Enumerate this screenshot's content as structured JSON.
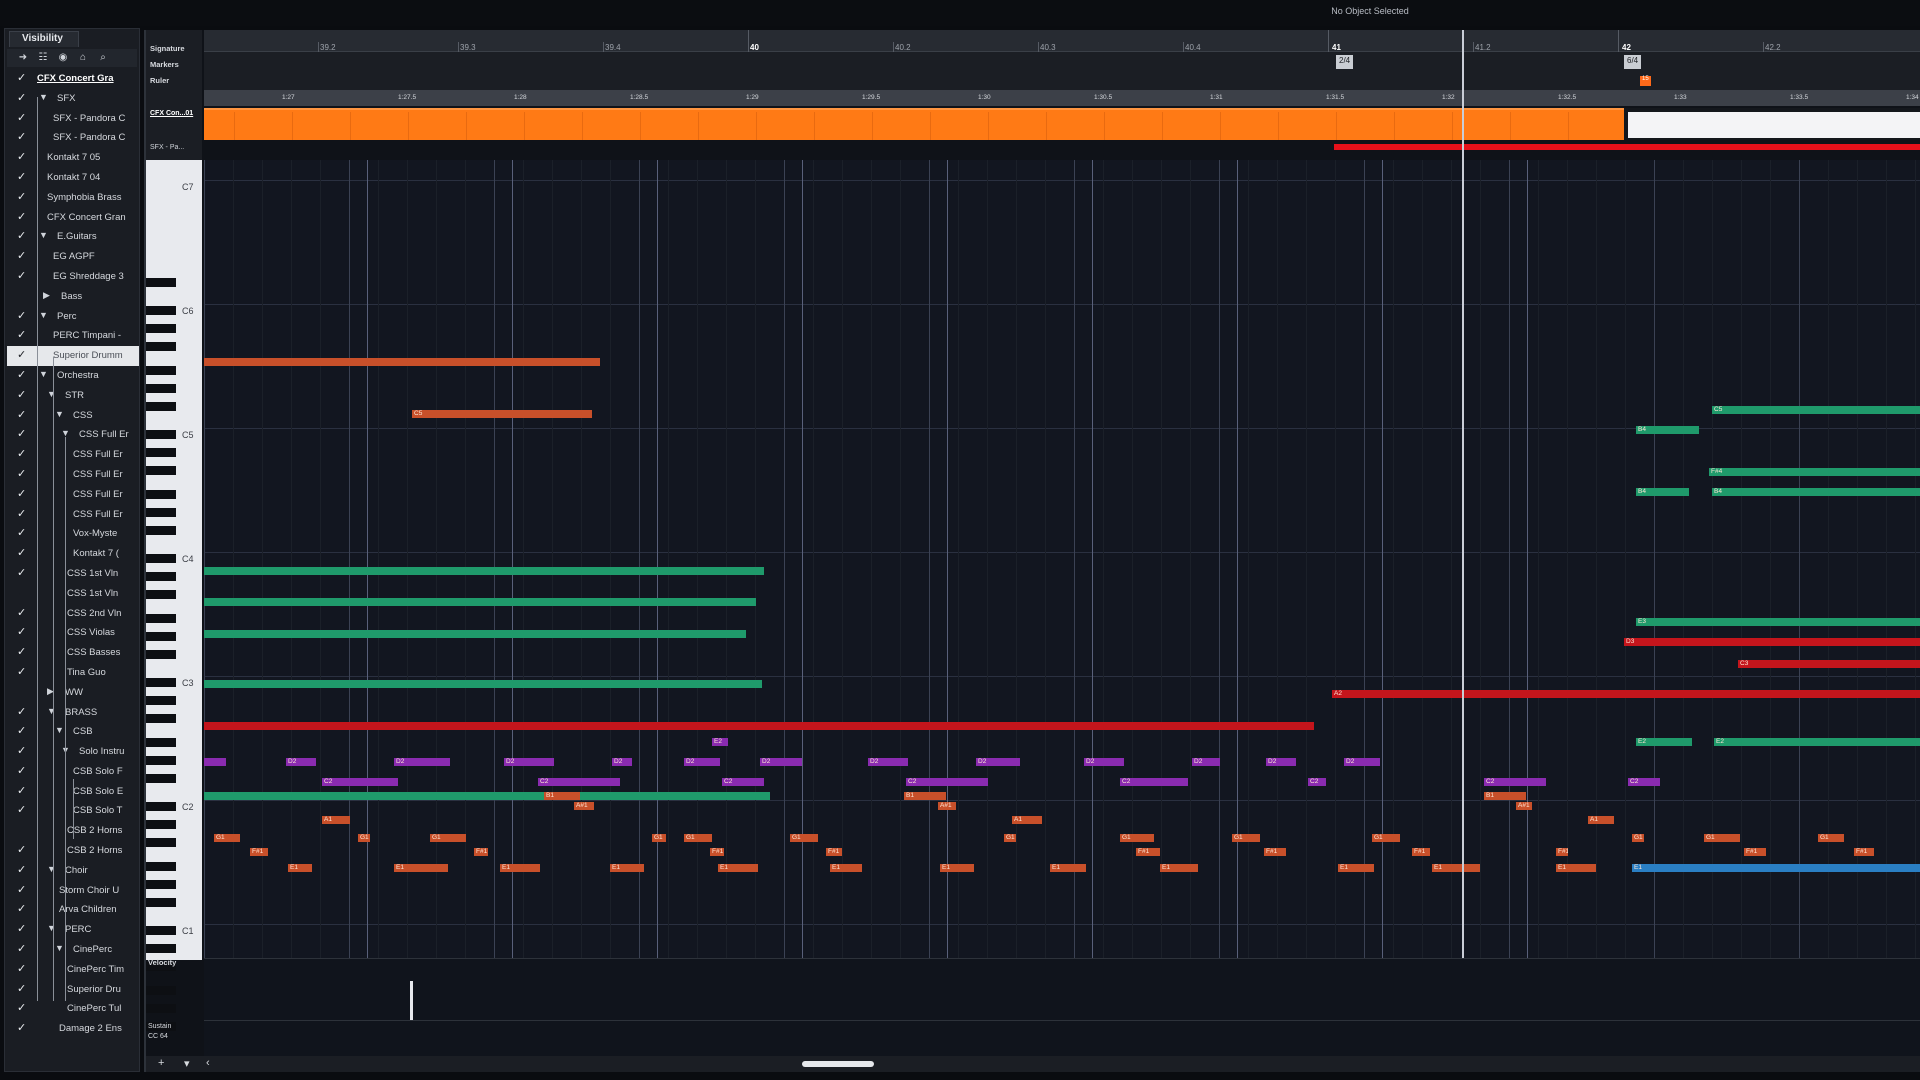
{
  "status": "No Object Selected",
  "visibility": {
    "tab_label": "Visibility",
    "toolbar_icons": [
      "arrow-right-icon",
      "tree-icon",
      "eye-icon",
      "lock-icon",
      "search-icon"
    ],
    "tracks": [
      {
        "label": "CFX Concert Gra",
        "checked": true,
        "bold": true
      },
      {
        "label": "SFX",
        "checked": true,
        "folder": "open"
      },
      {
        "label": "SFX - Pandora C",
        "checked": true
      },
      {
        "label": "SFX - Pandora C",
        "checked": true
      },
      {
        "label": "Kontakt 7 05",
        "checked": true
      },
      {
        "label": "Kontakt 7 04",
        "checked": true
      },
      {
        "label": "Symphobia Brass",
        "checked": true
      },
      {
        "label": "CFX Concert Gran",
        "checked": true
      },
      {
        "label": "E.Guitars",
        "checked": true,
        "folder": "open"
      },
      {
        "label": "EG AGPF",
        "checked": true
      },
      {
        "label": "EG Shreddage 3",
        "checked": true
      },
      {
        "label": "Bass",
        "checked": false,
        "folder": "closed"
      },
      {
        "label": "Perc",
        "checked": true,
        "folder": "open"
      },
      {
        "label": "PERC Timpani -",
        "checked": true
      },
      {
        "label": "Superior Drumm",
        "checked": true,
        "selected": true
      },
      {
        "label": "Orchestra",
        "checked": true,
        "folder": "open"
      },
      {
        "label": "STR",
        "checked": true,
        "folder": "open"
      },
      {
        "label": "CSS",
        "checked": true,
        "folder": "open"
      },
      {
        "label": "CSS Full Er",
        "checked": true,
        "folder": "open"
      },
      {
        "label": "CSS Full Er",
        "checked": true
      },
      {
        "label": "CSS Full Er",
        "checked": true
      },
      {
        "label": "CSS Full Er",
        "checked": true
      },
      {
        "label": "CSS Full Er",
        "checked": true
      },
      {
        "label": "Vox-Myste",
        "checked": true
      },
      {
        "label": "Kontakt 7 (",
        "checked": true
      },
      {
        "label": "CSS 1st Vln",
        "checked": true
      },
      {
        "label": "CSS 1st Vln",
        "checked": false
      },
      {
        "label": "CSS 2nd Vln",
        "checked": true
      },
      {
        "label": "CSS Violas",
        "checked": true
      },
      {
        "label": "CSS Basses",
        "checked": true
      },
      {
        "label": "Tina Guo",
        "checked": true
      },
      {
        "label": "WW",
        "checked": false,
        "folder": "closed"
      },
      {
        "label": "BRASS",
        "checked": true,
        "folder": "open"
      },
      {
        "label": "CSB",
        "checked": true,
        "folder": "open"
      },
      {
        "label": "Solo Instru",
        "checked": true,
        "folder": "open"
      },
      {
        "label": "CSB Solo F",
        "checked": true
      },
      {
        "label": "CSB Solo E",
        "checked": true
      },
      {
        "label": "CSB Solo T",
        "checked": true
      },
      {
        "label": "CSB 2 Horns",
        "checked": false
      },
      {
        "label": "CSB 2 Horns",
        "checked": true
      },
      {
        "label": "Choir",
        "checked": true,
        "folder": "open"
      },
      {
        "label": "Storm Choir U",
        "checked": true
      },
      {
        "label": "Arva Children",
        "checked": true
      },
      {
        "label": "PERC",
        "checked": true,
        "folder": "open"
      },
      {
        "label": "CinePerc",
        "checked": true,
        "folder": "open"
      },
      {
        "label": "CinePerc Tim",
        "checked": true
      },
      {
        "label": "Superior Dru",
        "checked": true
      },
      {
        "label": "CinePerc Tul",
        "checked": true
      },
      {
        "label": "Damage 2 Ens",
        "checked": true
      }
    ]
  },
  "lanes": {
    "signature": "Signature",
    "markers": "Markers",
    "ruler": "Ruler",
    "part_name": "CFX Con...01",
    "part_name2": "SFX - Pa...",
    "velocity": "Velocity",
    "cc_line1": "Sustain",
    "cc_line2": "CC 64"
  },
  "ruler": {
    "bars": [
      {
        "label": "39.2"
      },
      {
        "label": "39.3"
      },
      {
        "label": "39.4"
      },
      {
        "label": "40",
        "major": true
      },
      {
        "label": "40.2"
      },
      {
        "label": "40.3"
      },
      {
        "label": "40.4"
      },
      {
        "label": "41",
        "major": true
      },
      {
        "label": "41.2"
      },
      {
        "label": "42",
        "major": true
      },
      {
        "label": "42.2"
      }
    ],
    "times": [
      "1:27",
      "1:27.5",
      "1:28",
      "1:28.5",
      "1:29",
      "1:29.5",
      "1:30",
      "1:30.5",
      "1:31",
      "1:31.5",
      "1:32",
      "1:32.5",
      "1:33",
      "1:33.5",
      "1:34"
    ],
    "signatures": [
      "2/4",
      "6/4"
    ],
    "marker": "15"
  },
  "keys": [
    "C7",
    "C6",
    "C5",
    "C4",
    "C3",
    "C2",
    "C1"
  ],
  "notes": [
    {
      "l": "",
      "c": "orange"
    },
    {
      "l": "C5",
      "c": "orange"
    },
    {
      "l": "",
      "c": "green"
    },
    {
      "l": "",
      "c": "green"
    },
    {
      "l": "",
      "c": "green"
    },
    {
      "l": "",
      "c": "green"
    },
    {
      "l": "",
      "c": "red"
    },
    {
      "l": "A2",
      "c": "red"
    },
    {
      "l": "B4",
      "c": "green"
    },
    {
      "l": "C5",
      "c": "green"
    },
    {
      "l": "F#4",
      "c": "green"
    },
    {
      "l": "B4",
      "c": "green"
    },
    {
      "l": "B4",
      "c": "green"
    },
    {
      "l": "E3",
      "c": "green"
    },
    {
      "l": "D3",
      "c": "red"
    },
    {
      "l": "C3",
      "c": "red"
    },
    {
      "l": "E2",
      "c": "green"
    },
    {
      "l": "E2",
      "c": "green"
    },
    {
      "l": "E2",
      "c": "purple"
    },
    {
      "l": "",
      "c": "purple"
    },
    {
      "l": "D2",
      "c": "purple"
    },
    {
      "l": "D2",
      "c": "purple"
    },
    {
      "l": "D2",
      "c": "purple"
    },
    {
      "l": "D2",
      "c": "purple"
    },
    {
      "l": "D2",
      "c": "purple"
    },
    {
      "l": "D2",
      "c": "purple"
    },
    {
      "l": "D2",
      "c": "purple"
    },
    {
      "l": "D2",
      "c": "purple"
    },
    {
      "l": "D2",
      "c": "purple"
    },
    {
      "l": "D2",
      "c": "purple"
    },
    {
      "l": "D2",
      "c": "purple"
    },
    {
      "l": "D2",
      "c": "purple"
    },
    {
      "l": "C2",
      "c": "purple"
    },
    {
      "l": "C2",
      "c": "purple"
    },
    {
      "l": "C2",
      "c": "purple"
    },
    {
      "l": "C2",
      "c": "purple"
    },
    {
      "l": "C2",
      "c": "purple"
    },
    {
      "l": "C2",
      "c": "purple"
    },
    {
      "l": "C2",
      "c": "purple"
    },
    {
      "l": "C2",
      "c": "purple"
    },
    {
      "l": "",
      "c": "green"
    },
    {
      "l": "B1",
      "c": "orange"
    },
    {
      "l": "B1",
      "c": "orange"
    },
    {
      "l": "B1",
      "c": "orange"
    },
    {
      "l": "A#1",
      "c": "orange"
    },
    {
      "l": "A#1",
      "c": "orange"
    },
    {
      "l": "A#1",
      "c": "orange"
    },
    {
      "l": "A1",
      "c": "orange"
    },
    {
      "l": "A1",
      "c": "orange"
    },
    {
      "l": "A1",
      "c": "orange"
    },
    {
      "l": "G1",
      "c": "orange"
    },
    {
      "l": "G1",
      "c": "orange"
    },
    {
      "l": "G1",
      "c": "orange"
    },
    {
      "l": "G1",
      "c": "orange"
    },
    {
      "l": "G1",
      "c": "orange"
    },
    {
      "l": "G1",
      "c": "orange"
    },
    {
      "l": "G1",
      "c": "orange"
    },
    {
      "l": "G1",
      "c": "orange"
    },
    {
      "l": "G1",
      "c": "orange"
    },
    {
      "l": "G1",
      "c": "orange"
    },
    {
      "l": "G1",
      "c": "orange"
    },
    {
      "l": "G1",
      "c": "orange"
    },
    {
      "l": "G1",
      "c": "orange"
    },
    {
      "l": "G1",
      "c": "orange"
    },
    {
      "l": "F#1",
      "c": "orange"
    },
    {
      "l": "F#1",
      "c": "orange"
    },
    {
      "l": "F#1",
      "c": "orange"
    },
    {
      "l": "F#1",
      "c": "orange"
    },
    {
      "l": "F#1",
      "c": "orange"
    },
    {
      "l": "F#1",
      "c": "orange"
    },
    {
      "l": "F#1",
      "c": "orange"
    },
    {
      "l": "F#1",
      "c": "orange"
    },
    {
      "l": "F#1",
      "c": "orange"
    },
    {
      "l": "F#1",
      "c": "orange"
    },
    {
      "l": "E1",
      "c": "orange"
    },
    {
      "l": "E1",
      "c": "orange"
    },
    {
      "l": "E1",
      "c": "orange"
    },
    {
      "l": "E1",
      "c": "orange"
    },
    {
      "l": "E1",
      "c": "orange"
    },
    {
      "l": "E1",
      "c": "orange"
    },
    {
      "l": "E1",
      "c": "orange"
    },
    {
      "l": "E1",
      "c": "orange"
    },
    {
      "l": "E1",
      "c": "orange"
    },
    {
      "l": "E1",
      "c": "orange"
    },
    {
      "l": "E1",
      "c": "orange"
    },
    {
      "l": "E1",
      "c": "orange"
    },
    {
      "l": "E1",
      "c": "orange"
    },
    {
      "l": "E1",
      "c": "blue"
    }
  ],
  "colors": {
    "orange": "#c8502a",
    "green": "#1f9a6b",
    "red": "#c4151c",
    "purple": "#8a2bb0",
    "blue": "#2a7fc4",
    "part": "#ff7a15"
  },
  "toolbar_bottom": {
    "add": "+",
    "menu": "▾",
    "left": "‹"
  }
}
